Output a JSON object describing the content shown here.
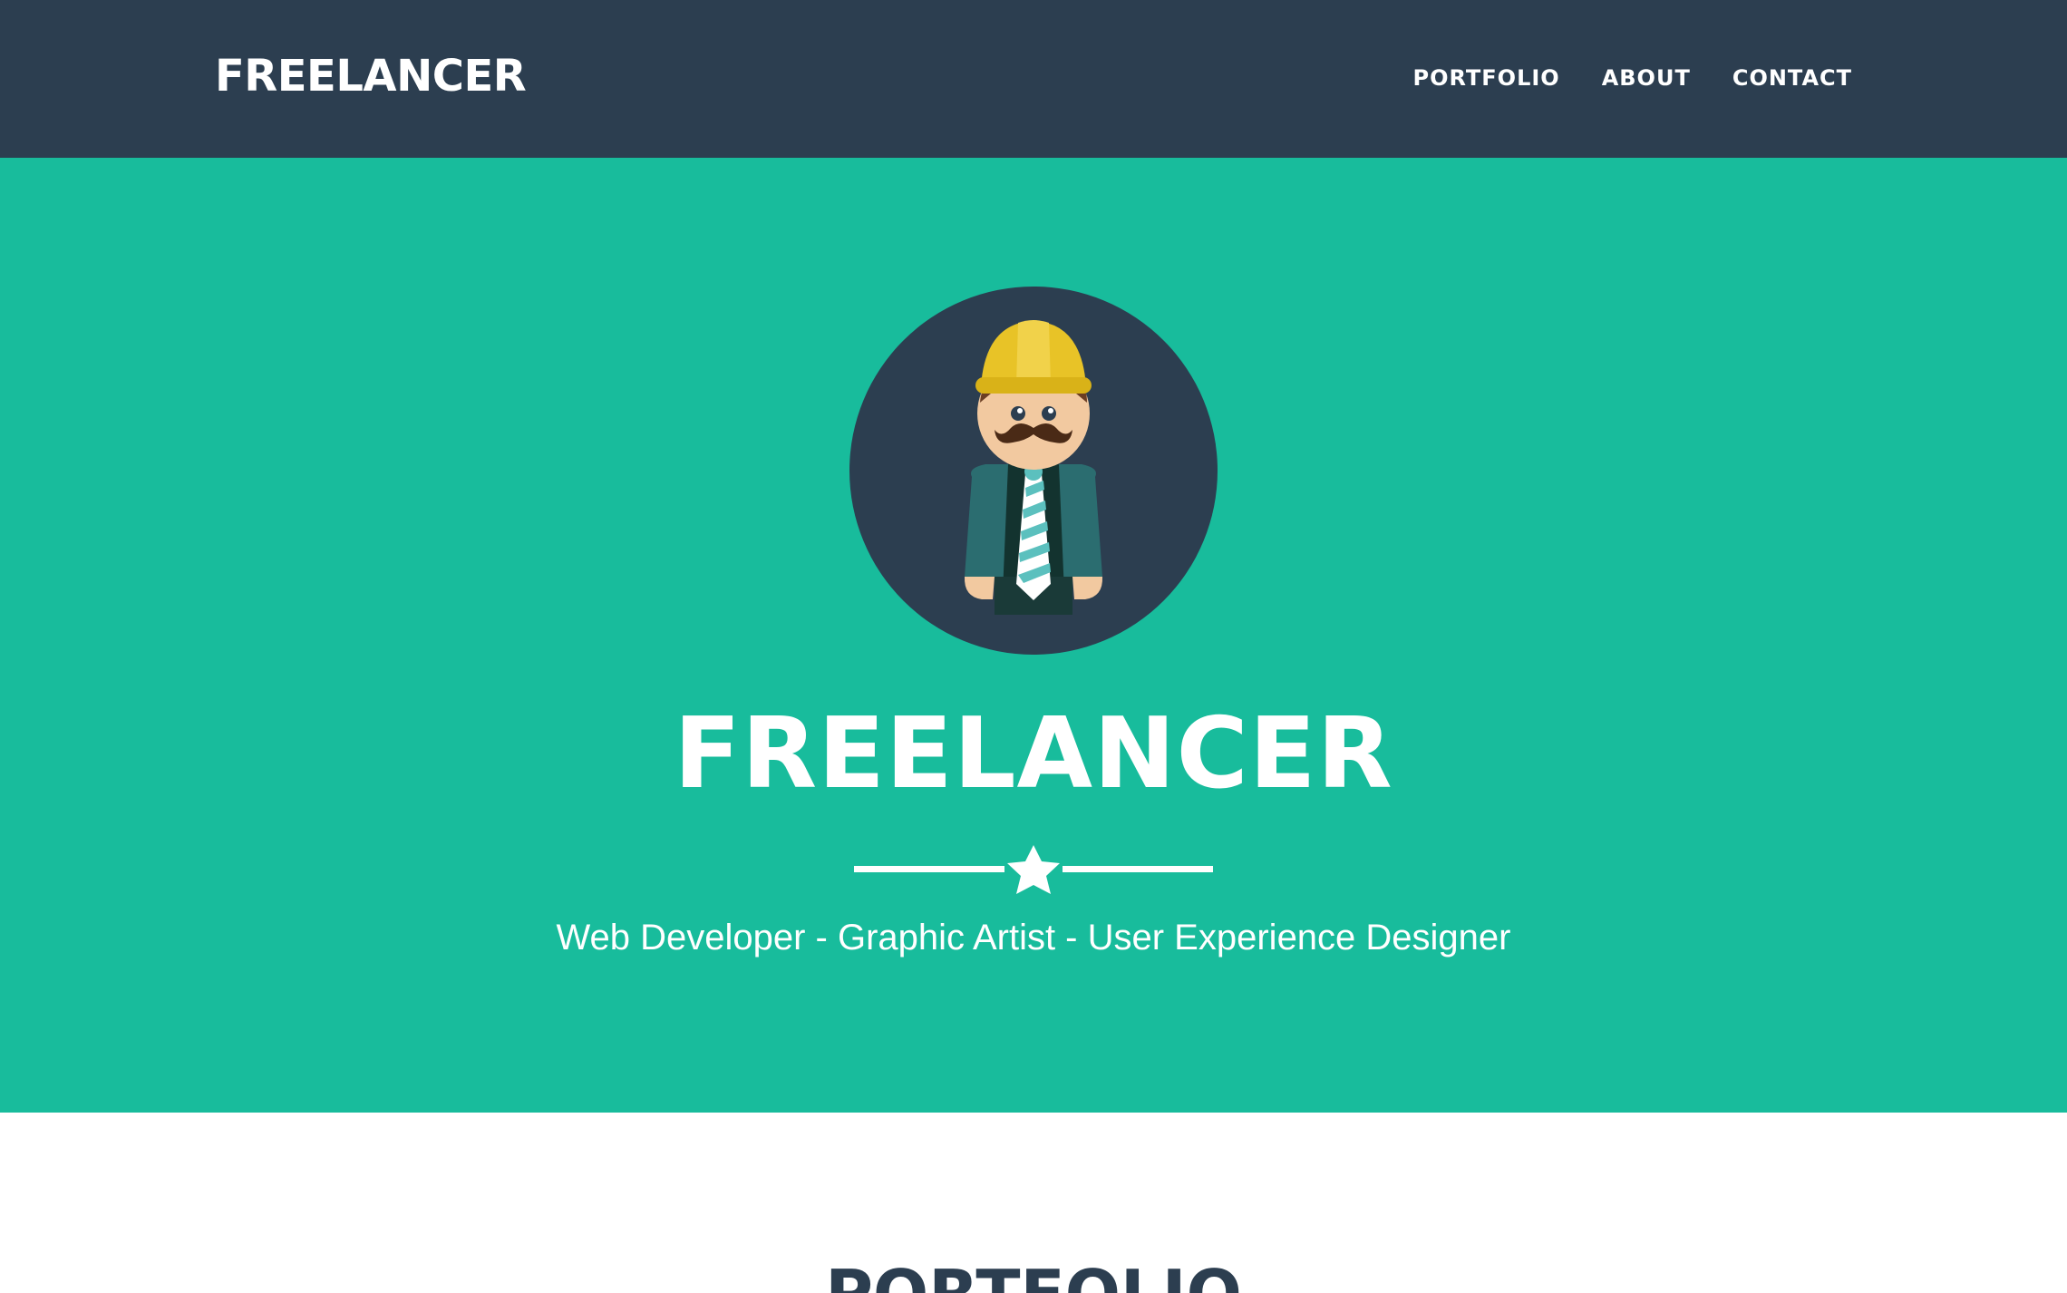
{
  "navbar": {
    "brand": "FREELANCER",
    "links": [
      {
        "label": "PORTFOLIO"
      },
      {
        "label": "ABOUT"
      },
      {
        "label": "CONTACT"
      }
    ]
  },
  "hero": {
    "avatar_icon": "freelancer-avatar-icon",
    "title": "FREELANCER",
    "divider_icon": "star-icon",
    "subtitle": "Web Developer - Graphic Artist - User Experience Designer"
  },
  "portfolio": {
    "heading": "PORTFOLIO"
  },
  "colors": {
    "navbar_bg": "#2c3e50",
    "hero_bg": "#18bc9c",
    "text_light": "#ffffff",
    "text_dark": "#2c3e50",
    "helmet": "#e8c327",
    "skin": "#f2c9a0"
  }
}
